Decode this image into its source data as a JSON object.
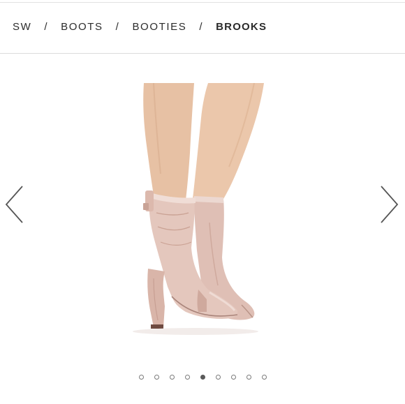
{
  "breadcrumb": {
    "items": [
      "SW",
      "BOOTS",
      "BOOTIES"
    ],
    "current": "BROOKS",
    "separator": "/"
  },
  "gallery": {
    "prev_icon": "chevron-left-icon",
    "next_icon": "chevron-right-icon",
    "image_subject": "blush suede slouchy block-heel ankle booties",
    "dot_count": 9,
    "active_dot": 5,
    "colors": {
      "suede": "#e2c6bd",
      "skin": "#e8c2a3",
      "background": "#ffffff"
    }
  }
}
